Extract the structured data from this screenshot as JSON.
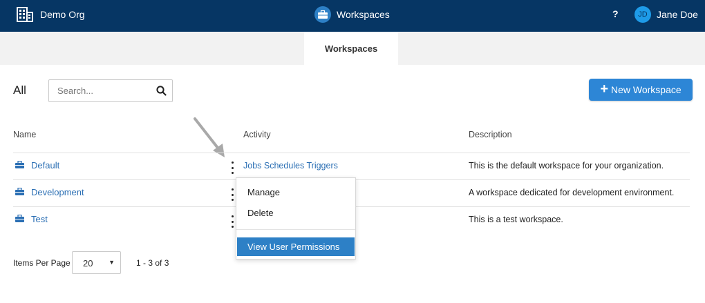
{
  "header": {
    "org_name": "Demo Org",
    "app_title": "Workspaces",
    "help_label": "?",
    "user_initials": "JD",
    "user_name": "Jane Doe"
  },
  "tabs": [
    {
      "label": "Workspaces",
      "active": true
    }
  ],
  "toolbar": {
    "filter_label": "All",
    "search_placeholder": "Search...",
    "search_value": "",
    "new_button_label": "New Workspace"
  },
  "table": {
    "columns": [
      "Name",
      "Activity",
      "Description"
    ],
    "rows": [
      {
        "name": "Default",
        "activity": "Jobs Schedules Triggers",
        "description": "This is the default workspace for your organization."
      },
      {
        "name": "Development",
        "activity": "",
        "description": "A workspace dedicated for development environment."
      },
      {
        "name": "Test",
        "activity": "",
        "description": "This is a test workspace."
      }
    ]
  },
  "row_menu": {
    "items": [
      "Manage",
      "Delete"
    ],
    "highlighted_item": "View User Permissions"
  },
  "pagination": {
    "items_per_page_label": "Items Per Page",
    "items_per_page_value": "20",
    "range_text": "1 - 3 of 3"
  },
  "colors": {
    "header_bg": "#063664",
    "accent_blue": "#2d80c6",
    "link_blue": "#2b6fb4",
    "button_blue": "#2d86d6"
  }
}
